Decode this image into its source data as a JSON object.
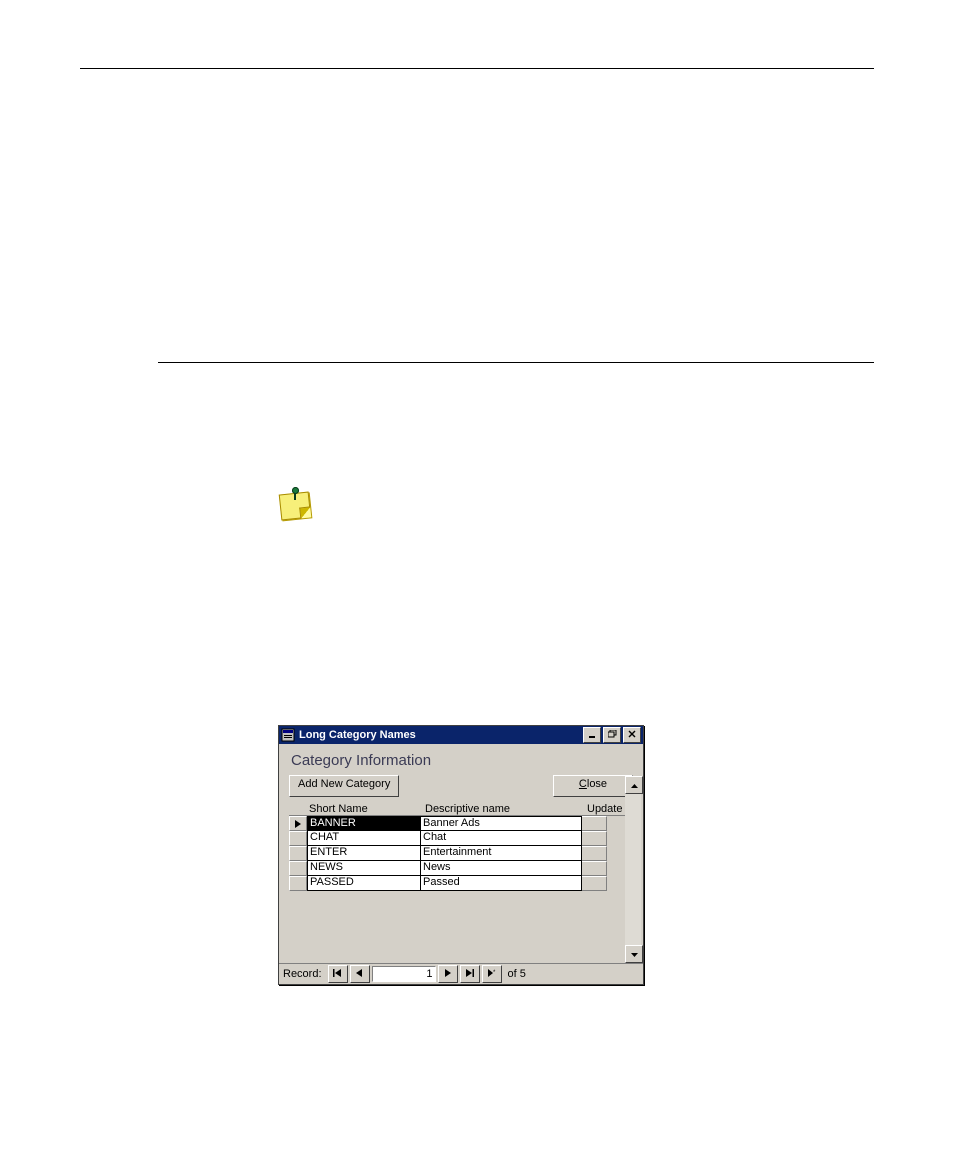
{
  "dialog": {
    "title": "Long Category Names",
    "heading": "Category Information",
    "add_button_label": "Add New Category",
    "close_button_label": "Close",
    "close_button_accesskey": "C",
    "columns": {
      "short": "Short Name",
      "desc": "Descriptive name",
      "update": "Update"
    },
    "rows": [
      {
        "short": "BANNER",
        "desc": "Banner Ads",
        "current": true
      },
      {
        "short": "CHAT",
        "desc": "Chat",
        "current": false
      },
      {
        "short": "ENTER",
        "desc": "Entertainment",
        "current": false
      },
      {
        "short": "NEWS",
        "desc": "News",
        "current": false
      },
      {
        "short": "PASSED",
        "desc": "Passed",
        "current": false
      }
    ],
    "record_nav": {
      "label": "Record:",
      "current": "1",
      "of_label": "of",
      "total": "5"
    },
    "icons": {
      "form": "form-icon",
      "minimize": "minimize-icon",
      "restore": "restore-icon",
      "close": "close-icon",
      "first": "nav-first-icon",
      "prev": "nav-prev-icon",
      "next": "nav-next-icon",
      "last": "nav-last-icon",
      "new": "nav-new-icon",
      "scroll_up": "scroll-up-icon",
      "scroll_down": "scroll-down-icon",
      "row_current": "row-current-indicator"
    }
  }
}
